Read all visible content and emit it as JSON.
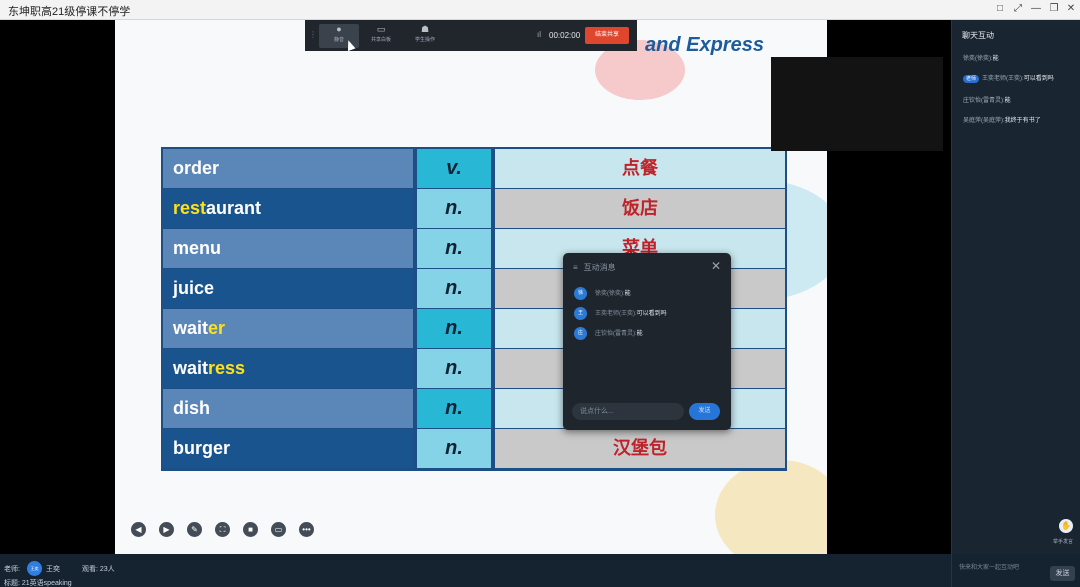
{
  "window": {
    "title": "东坤职高21级停课不停学",
    "controls": [
      "□",
      "⤢",
      "—",
      "❐",
      "✕"
    ]
  },
  "recording_bar": {
    "buttons": [
      {
        "icon": "microphone-icon",
        "label": "静音"
      },
      {
        "icon": "screen-share-icon",
        "label": "共享白板"
      },
      {
        "icon": "members-icon",
        "label": "学生操作"
      }
    ],
    "signal": "ıl",
    "timer": "00:02:00",
    "stop_label": "结束共享"
  },
  "slide": {
    "heading": "and Express",
    "rows": [
      {
        "pre": "order",
        "hl": "",
        "post": "",
        "pos": "v.",
        "meaning": "点餐"
      },
      {
        "pre": "",
        "hl": "rest",
        "post": "aurant",
        "pos": "n.",
        "meaning": "饭店"
      },
      {
        "pre": "menu",
        "hl": "",
        "post": "",
        "pos": "n.",
        "meaning": "菜单"
      },
      {
        "pre": "juice",
        "hl": "",
        "post": "",
        "pos": "n.",
        "meaning": ""
      },
      {
        "pre": "wait",
        "hl": "er",
        "post": "",
        "pos": "n.",
        "meaning": ""
      },
      {
        "pre": "wait",
        "hl": "ress",
        "post": "",
        "pos": "n.",
        "meaning": ""
      },
      {
        "pre": "dish",
        "hl": "",
        "post": "",
        "pos": "n.",
        "meaning": ""
      },
      {
        "pre": "burger",
        "hl": "",
        "post": "",
        "pos": "n.",
        "meaning": "汉堡包"
      }
    ],
    "controls": [
      "◀",
      "▶",
      "✎",
      "⛶",
      "■",
      "▭",
      "•••"
    ]
  },
  "popup": {
    "title": "互动消息",
    "close": "✕",
    "messages": [
      {
        "avatar": "徐",
        "sender": "徐奕(徐奕):",
        "text": "能"
      },
      {
        "avatar": "王",
        "sender": "王奕老师(王奕):",
        "text": "可以看到吗"
      },
      {
        "avatar": "庄",
        "sender": "庄钦怡(雷青灵):",
        "text": "能"
      }
    ],
    "input_placeholder": "说点什么...",
    "send_label": "发送"
  },
  "chat": {
    "header": "聊天互动",
    "messages": [
      {
        "tag": "",
        "sender": "徐奕(徐奕):",
        "text": "能"
      },
      {
        "tag": "老师",
        "sender": "王奕老师(王奕):",
        "text": "可以看到吗"
      },
      {
        "tag": "",
        "sender": "庄钦怡(雷青灵):",
        "text": "能"
      },
      {
        "tag": "",
        "sender": "吴庭萍(吴庭萍):",
        "text": "我终于有书了"
      }
    ],
    "hand_label": "举手发言",
    "input_placeholder": "快来和大家一起互动吧",
    "send_label": "发送"
  },
  "status": {
    "teacher_label": "老师:",
    "teacher_avatar": "王奕",
    "teacher_name": "王奕",
    "viewers_label": "观看: 23人",
    "topic_label": "标题: 21英语speaking"
  }
}
